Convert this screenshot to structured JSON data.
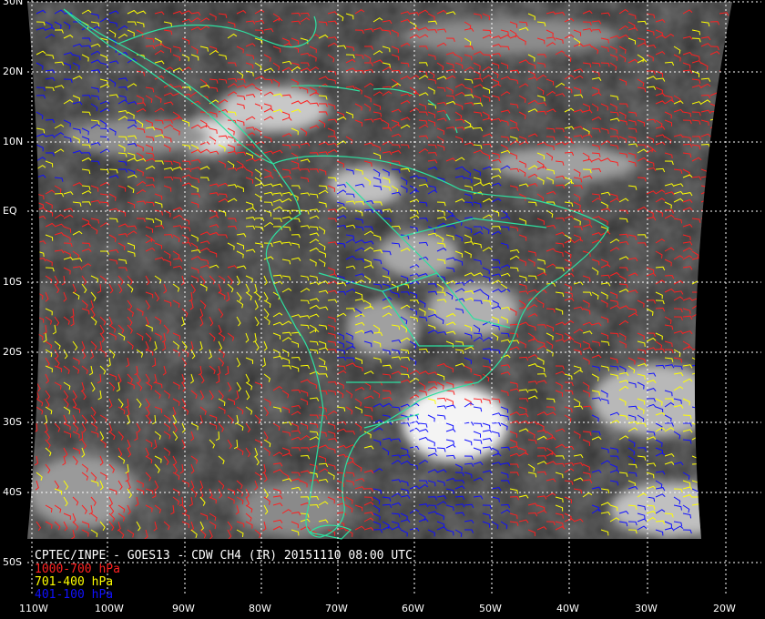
{
  "title": "CPTEC/INPE - GOES13 - CDW CH4 (IR) 20151110 08:00 UTC",
  "legend": [
    {
      "label": "1000-700 hPa",
      "color": "#ff2020"
    },
    {
      "label": "701-400 hPa",
      "color": "#ffff00"
    },
    {
      "label": "401-100 hPa",
      "color": "#1010ff"
    }
  ],
  "lat_labels": [
    "30N",
    "20N",
    "10N",
    "EQ",
    "10S",
    "20S",
    "30S",
    "40S",
    "50S"
  ],
  "lon_labels": [
    "110W",
    "100W",
    "90W",
    "80W",
    "70W",
    "60W",
    "50W",
    "40W",
    "30W",
    "20W"
  ],
  "colors": {
    "background": "#000000",
    "coastline": "#2de0a0",
    "grid": "#ffffff",
    "label": "#ffffff"
  }
}
